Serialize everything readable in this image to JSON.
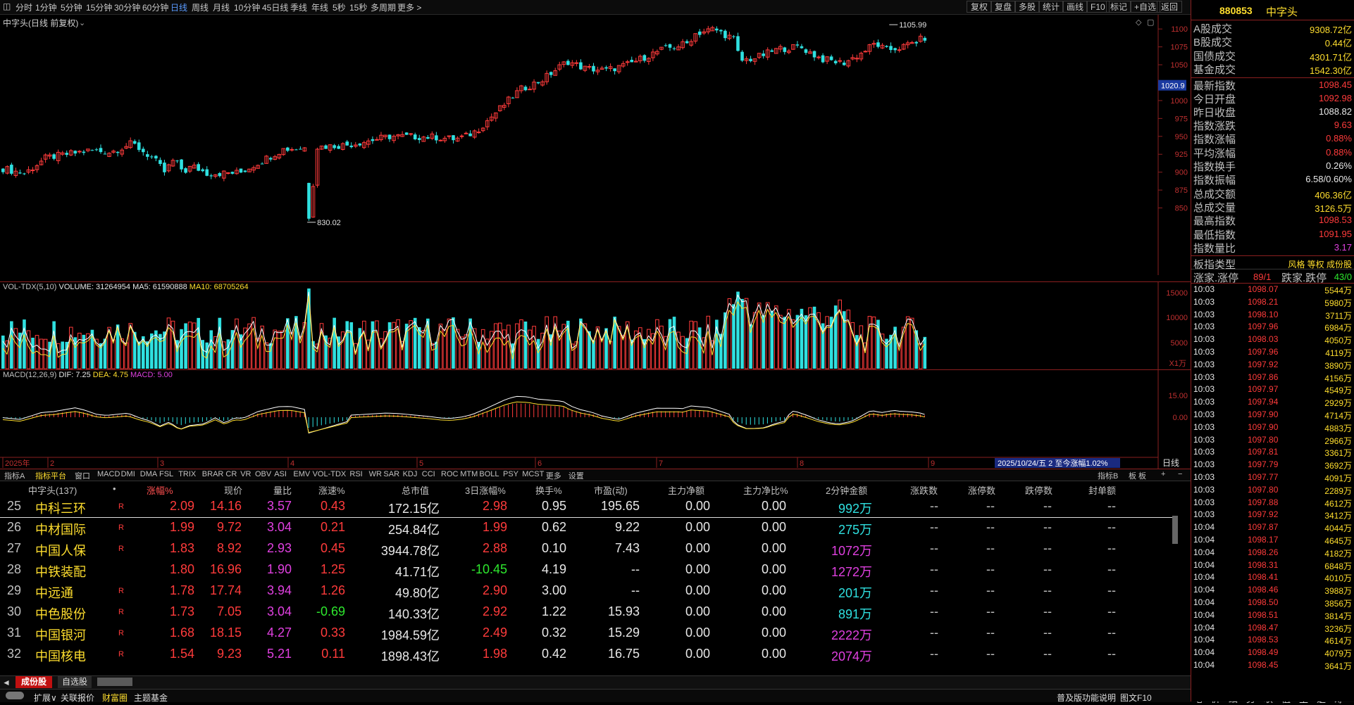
{
  "toolbar": {
    "periods": [
      "分时",
      "1分钟",
      "5分钟",
      "15分钟",
      "30分钟",
      "60分钟",
      "日线",
      "周线",
      "月线",
      "10分钟",
      "45日线",
      "季线",
      "年线",
      "5秒",
      "15秒",
      "多周期",
      "更多 >"
    ],
    "active_period": "日线",
    "right_buttons": [
      "复权",
      "复盘",
      "多股",
      "统计",
      "画线",
      "F10",
      "标记",
      "+自选",
      "返回"
    ]
  },
  "chart": {
    "title": "中字头(日线 前复权)",
    "high_label": "1105.99",
    "low_label": "830.02",
    "current_price_tag": "1020.9",
    "price_ticks": [
      "1100",
      "1075",
      "1050",
      "1000",
      "975",
      "950",
      "925",
      "900",
      "875",
      "850"
    ],
    "date_ticks": [
      "2025年",
      "2",
      "3",
      "4",
      "5",
      "6",
      "7",
      "8",
      "9"
    ],
    "vol_label_prefix": "VOL-TDX(5,10)",
    "vol_value": "VOLUME: 31264954",
    "vol_ma5": "MA5: 61590888",
    "vol_ma10": "MA10: 68705264",
    "vol_ticks": [
      "15000",
      "10000",
      "5000"
    ],
    "vol_unit": "X1万",
    "macd_label_prefix": "MACD(12,26,9)",
    "macd_dif": "DIF: 7.25",
    "macd_dea": "DEA: 4.75",
    "macd_macd": "MACD: 5.00",
    "macd_ticks": [
      "15.00",
      "0.00"
    ],
    "date_highlight": "2025/10/24/五 2 至今涨幅1.02%",
    "period_label": "日线"
  },
  "chart_data": {
    "type": "candlestick",
    "title": "中字头(日线 前复权)",
    "y_range": [
      830.02,
      1105.99
    ],
    "annotated": {
      "high": 1105.99,
      "low": 830.02,
      "last_tag": 1020.9
    },
    "volume": {
      "last": 31264954,
      "ma5": 61590888,
      "ma10": 68705264,
      "unit": "X1万"
    },
    "macd": {
      "dif": 7.25,
      "dea": 4.75,
      "macd": 5.0
    }
  },
  "indicator_tabs": [
    "指标A",
    "指标平台",
    "窗口",
    "MACD",
    "DMI",
    "DMA",
    "FSL",
    "TRIX",
    "BRAR",
    "CR",
    "VR",
    "OBV",
    "ASI",
    "EMV",
    "VOL-TDX",
    "RSI",
    "WR",
    "SAR",
    "KDJ",
    "CCI",
    "ROC",
    "MTM",
    "BOLL",
    "PSY",
    "MCST",
    "更多",
    "设置"
  ],
  "indicator_right": [
    "指标B",
    "板 板",
    "+",
    "−"
  ],
  "table": {
    "header": {
      "name": "中字头(137)",
      "dot": "•",
      "chg": "涨幅%",
      "price": "现价",
      "vr": "量比",
      "spd": "涨速%",
      "cap": "总市值",
      "chg3": "3日涨幅%",
      "turn": "换手%",
      "pe": "市盈(动)",
      "main": "主力净额",
      "mainr": "主力净比%",
      "amt2": "2分钟金额",
      "ud": "涨跌数",
      "lu": "涨停数",
      "ld": "跌停数",
      "seal": "封单额"
    },
    "rows": [
      {
        "no": "25",
        "name": "中科三环",
        "r": "R",
        "chg": "2.09",
        "price": "14.16",
        "vr": "3.57",
        "spd": "0.43",
        "cap": "172.15亿",
        "chg3": "2.98",
        "turn": "0.95",
        "pe": "195.65",
        "main": "0.00",
        "mainr": "0.00",
        "amt2": "992万",
        "ud": "--",
        "lu": "--",
        "ld": "--",
        "seal": "--"
      },
      {
        "no": "26",
        "name": "中材国际",
        "r": "R",
        "chg": "1.99",
        "price": "9.72",
        "vr": "3.04",
        "spd": "0.21",
        "cap": "254.84亿",
        "chg3": "1.99",
        "turn": "0.62",
        "pe": "9.22",
        "main": "0.00",
        "mainr": "0.00",
        "amt2": "275万",
        "ud": "--",
        "lu": "--",
        "ld": "--",
        "seal": "--"
      },
      {
        "no": "27",
        "name": "中国人保",
        "r": "R",
        "chg": "1.83",
        "price": "8.92",
        "vr": "2.93",
        "spd": "0.45",
        "cap": "3944.78亿",
        "chg3": "2.88",
        "turn": "0.10",
        "pe": "7.43",
        "main": "0.00",
        "mainr": "0.00",
        "amt2": "1072万",
        "ud": "--",
        "lu": "--",
        "ld": "--",
        "seal": "--"
      },
      {
        "no": "28",
        "name": "中铁装配",
        "r": "",
        "chg": "1.80",
        "price": "16.96",
        "vr": "1.90",
        "spd": "1.25",
        "cap": "41.71亿",
        "chg3": "-10.45",
        "turn": "4.19",
        "pe": "--",
        "main": "0.00",
        "mainr": "0.00",
        "amt2": "1272万",
        "ud": "--",
        "lu": "--",
        "ld": "--",
        "seal": "--"
      },
      {
        "no": "29",
        "name": "中远通",
        "r": "R",
        "chg": "1.78",
        "price": "17.74",
        "vr": "3.94",
        "spd": "1.26",
        "cap": "49.80亿",
        "chg3": "2.90",
        "turn": "3.00",
        "pe": "--",
        "main": "0.00",
        "mainr": "0.00",
        "amt2": "201万",
        "ud": "--",
        "lu": "--",
        "ld": "--",
        "seal": "--"
      },
      {
        "no": "30",
        "name": "中色股份",
        "r": "R",
        "chg": "1.73",
        "price": "7.05",
        "vr": "3.04",
        "spd": "-0.69",
        "cap": "140.33亿",
        "chg3": "2.92",
        "turn": "1.22",
        "pe": "15.93",
        "main": "0.00",
        "mainr": "0.00",
        "amt2": "891万",
        "ud": "--",
        "lu": "--",
        "ld": "--",
        "seal": "--"
      },
      {
        "no": "31",
        "name": "中国银河",
        "r": "R",
        "chg": "1.68",
        "price": "18.15",
        "vr": "4.27",
        "spd": "0.33",
        "cap": "1984.59亿",
        "chg3": "2.49",
        "turn": "0.32",
        "pe": "15.29",
        "main": "0.00",
        "mainr": "0.00",
        "amt2": "2222万",
        "ud": "--",
        "lu": "--",
        "ld": "--",
        "seal": "--"
      },
      {
        "no": "32",
        "name": "中国核电",
        "r": "R",
        "chg": "1.54",
        "price": "9.23",
        "vr": "5.21",
        "spd": "0.11",
        "cap": "1898.43亿",
        "chg3": "1.98",
        "turn": "0.42",
        "pe": "16.75",
        "main": "0.00",
        "mainr": "0.00",
        "amt2": "2074万",
        "ud": "--",
        "lu": "--",
        "ld": "--",
        "seal": "--"
      }
    ]
  },
  "bottom_tabs": {
    "t1": "成份股",
    "t2": "自选股"
  },
  "status_bar": {
    "items": [
      "扩展∨",
      "关联报价",
      "财富圈",
      "主题基金"
    ],
    "right": [
      "普及版功能说明",
      "图文F10"
    ],
    "rp_tabs": [
      "笔",
      "价",
      "细",
      "势",
      "联",
      "值",
      "主",
      "逆",
      "筹"
    ]
  },
  "right_panel": {
    "code": "880853",
    "name": "中字头",
    "stats": [
      {
        "label": "A股成交",
        "value": "9308.72亿",
        "color": "yellow"
      },
      {
        "label": "B股成交",
        "value": "0.44亿",
        "color": "yellow"
      },
      {
        "label": "国债成交",
        "value": "4301.71亿",
        "color": "yellow"
      },
      {
        "label": "基金成交",
        "value": "1542.30亿",
        "color": "yellow"
      },
      {
        "label": "最新指数",
        "value": "1098.45",
        "color": "red"
      },
      {
        "label": "今日开盘",
        "value": "1092.98",
        "color": "red"
      },
      {
        "label": "昨日收盘",
        "value": "1088.82",
        "color": "white"
      },
      {
        "label": "指数涨跌",
        "value": "9.63",
        "color": "red"
      },
      {
        "label": "指数涨幅",
        "value": "0.88%",
        "color": "red"
      },
      {
        "label": "平均涨幅",
        "value": "0.88%",
        "color": "red"
      },
      {
        "label": "指数换手",
        "value": "0.26%",
        "color": "white"
      },
      {
        "label": "指数振幅",
        "value": "6.58/0.60%",
        "color": "white"
      },
      {
        "label": "总成交额",
        "value": "406.36亿",
        "color": "yellow"
      },
      {
        "label": "总成交量",
        "value": "3126.5万",
        "color": "yellow"
      },
      {
        "label": "最高指数",
        "value": "1098.53",
        "color": "red"
      },
      {
        "label": "最低指数",
        "value": "1091.95",
        "color": "red"
      },
      {
        "label": "指数量比",
        "value": "3.17",
        "color": "purple"
      }
    ],
    "sector_type_label": "板指类型",
    "sector_type_value": "风格 等权 成份股",
    "updown_label": "涨家.涨停",
    "updown_value": "89/1",
    "down_label": "跌家.跌停",
    "down_value": "43/0",
    "ticks": [
      {
        "t": "10:03",
        "p": "1098.07",
        "v": "5544万"
      },
      {
        "t": "10:03",
        "p": "1098.21",
        "v": "5980万"
      },
      {
        "t": "10:03",
        "p": "1098.10",
        "v": "3711万"
      },
      {
        "t": "10:03",
        "p": "1097.96",
        "v": "6984万"
      },
      {
        "t": "10:03",
        "p": "1098.03",
        "v": "4050万"
      },
      {
        "t": "10:03",
        "p": "1097.96",
        "v": "4119万"
      },
      {
        "t": "10:03",
        "p": "1097.92",
        "v": "3890万"
      },
      {
        "t": "10:03",
        "p": "1097.86",
        "v": "4156万"
      },
      {
        "t": "10:03",
        "p": "1097.97",
        "v": "4549万"
      },
      {
        "t": "10:03",
        "p": "1097.94",
        "v": "2929万"
      },
      {
        "t": "10:03",
        "p": "1097.90",
        "v": "4714万"
      },
      {
        "t": "10:03",
        "p": "1097.90",
        "v": "4883万"
      },
      {
        "t": "10:03",
        "p": "1097.80",
        "v": "2966万"
      },
      {
        "t": "10:03",
        "p": "1097.81",
        "v": "3361万"
      },
      {
        "t": "10:03",
        "p": "1097.79",
        "v": "3692万"
      },
      {
        "t": "10:03",
        "p": "1097.77",
        "v": "4091万"
      },
      {
        "t": "10:03",
        "p": "1097.80",
        "v": "2289万"
      },
      {
        "t": "10:03",
        "p": "1097.88",
        "v": "4612万"
      },
      {
        "t": "10:03",
        "p": "1097.92",
        "v": "3412万"
      },
      {
        "t": "10:04",
        "p": "1097.87",
        "v": "4044万"
      },
      {
        "t": "10:04",
        "p": "1098.17",
        "v": "4645万"
      },
      {
        "t": "10:04",
        "p": "1098.26",
        "v": "4182万"
      },
      {
        "t": "10:04",
        "p": "1098.31",
        "v": "6848万"
      },
      {
        "t": "10:04",
        "p": "1098.41",
        "v": "4010万"
      },
      {
        "t": "10:04",
        "p": "1098.46",
        "v": "3988万"
      },
      {
        "t": "10:04",
        "p": "1098.50",
        "v": "3856万"
      },
      {
        "t": "10:04",
        "p": "1098.51",
        "v": "3814万"
      },
      {
        "t": "10:04",
        "p": "1098.47",
        "v": "3236万"
      },
      {
        "t": "10:04",
        "p": "1098.53",
        "v": "4614万"
      },
      {
        "t": "10:04",
        "p": "1098.49",
        "v": "4079万"
      },
      {
        "t": "10:04",
        "p": "1098.45",
        "v": "3641万"
      }
    ]
  }
}
